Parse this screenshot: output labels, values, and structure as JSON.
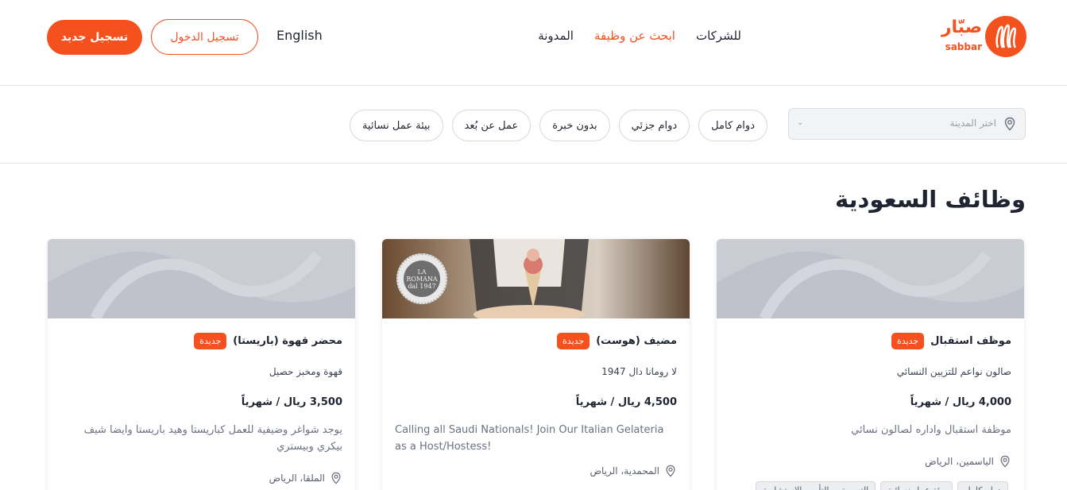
{
  "header": {
    "register_label": "تسجيل جديد",
    "login_label": "تسجيل الدخول",
    "language_label": "English",
    "nav": {
      "companies": "للشركات",
      "find_job": "ابحث عن وظيفة",
      "blog": "المدونة"
    },
    "logo": {
      "arabic": "صبّار",
      "latin": "sabbar"
    }
  },
  "filters": {
    "city_placeholder": "اختر المدينة",
    "chips": [
      "دوام كامل",
      "دوام جزئي",
      "بدون خبرة",
      "عمل عن بُعد",
      "بيئة عمل نسائية"
    ]
  },
  "page_title": "وظائف السعودية",
  "cards": [
    {
      "title": "موظف استقبال",
      "badge": "جديدة",
      "company": "صالون نواعم للتزيين النسائي",
      "salary": "4,000 ريال / شهرياً",
      "description": "موظفة استقبال واداره لصالون نسائي",
      "location": "الياسمين، الرياض",
      "tags": [
        "دوام كامل",
        "بيئة عمل نسائية",
        "التسويق و التأمين الاستشارية"
      ]
    },
    {
      "title": "مضيف (هوست)",
      "badge": "جديدة",
      "company": "لا رومانا دال 1947",
      "salary": "4,500 ريال / شهرياً",
      "description": "Calling all Saudi Nationals! Join Our Italian Gelateria as a Host/Hostess!",
      "location": "المحمدية، الرياض",
      "logo_text": "LA ROMANA dal 1947"
    },
    {
      "title": "محضر قهوة (باريستا)",
      "badge": "جديدة",
      "company": "قهوة ومخبز حصيل",
      "salary": "3,500 ريال / شهرياً",
      "description": "يوجد شواغر وضيفية للعمل كباريستا وهيد باريستا وايضا شيف بيكري وبيستري",
      "location": "الملقا، الرياض"
    }
  ],
  "colors": {
    "accent": "#f4511e",
    "text": "#1f2430",
    "muted": "#6b7080",
    "placeholder_image": "#bfc2ca"
  }
}
